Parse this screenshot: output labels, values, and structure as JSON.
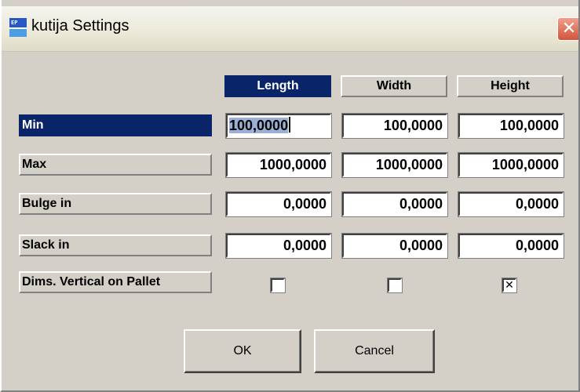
{
  "window": {
    "title": "kutija Settings",
    "close_glyph": "✕",
    "icon": "app-icon",
    "icon_text": "EP"
  },
  "columns": [
    "Length",
    "Width",
    "Height"
  ],
  "rows": [
    {
      "label": "Min",
      "values": [
        "100,0000",
        "100,0000",
        "100,0000"
      ]
    },
    {
      "label": "Max",
      "values": [
        "1000,0000",
        "1000,0000",
        "1000,0000"
      ]
    },
    {
      "label": "Bulge in",
      "values": [
        "0,0000",
        "0,0000",
        "0,0000"
      ]
    },
    {
      "label": "Slack in",
      "values": [
        "0,0000",
        "0,0000",
        "0,0000"
      ]
    }
  ],
  "dims_vertical": {
    "label": "Dims. Vertical on Pallet",
    "checked": [
      false,
      false,
      true
    ],
    "check_glyph": "✕"
  },
  "buttons": {
    "ok": "OK",
    "cancel": "Cancel"
  },
  "colors": {
    "selection": "#0a246a",
    "face": "#d4d0c8",
    "close": "#d4543a"
  }
}
